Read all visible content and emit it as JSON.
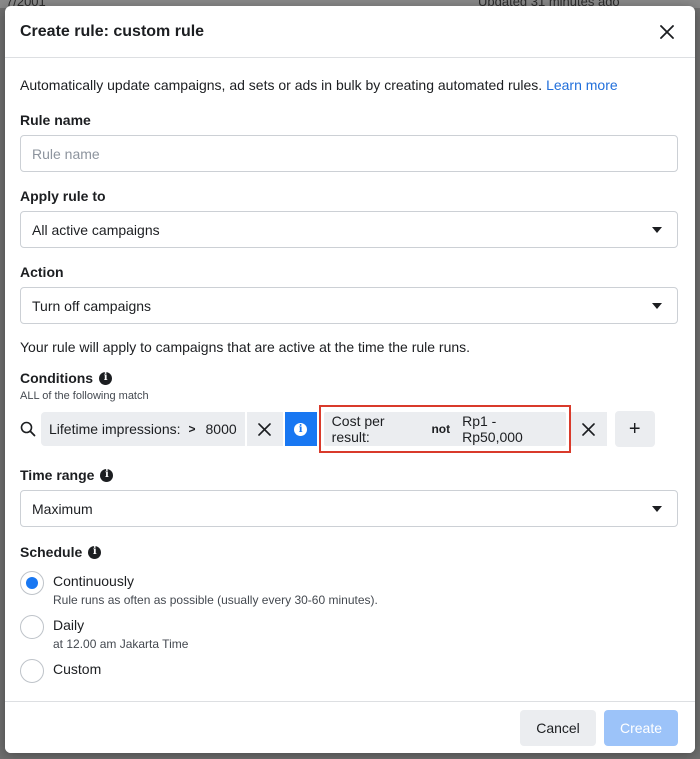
{
  "background": {
    "top_left_text": "7/2001",
    "top_right_text": "Updated 31 minutes ago"
  },
  "modal": {
    "title": "Create rule: custom rule",
    "intro_text": "Automatically update campaigns, ad sets or ads in bulk by creating automated rules.",
    "learn_more": "Learn more",
    "rule_name": {
      "label": "Rule name",
      "placeholder": "Rule name",
      "value": ""
    },
    "apply_rule_to": {
      "label": "Apply rule to",
      "value": "All active campaigns"
    },
    "action": {
      "label": "Action",
      "value": "Turn off campaigns"
    },
    "apply_note": "Your rule will apply to campaigns that are active at the time the rule runs.",
    "conditions": {
      "label": "Conditions",
      "sublabel": "ALL of the following match",
      "items": [
        {
          "metric": "Lifetime impressions:",
          "operator": ">",
          "value": "8000"
        },
        {
          "metric": "Cost per result:",
          "operator": "not",
          "value": "Rp1 - Rp50,000"
        }
      ],
      "add_label": "+"
    },
    "time_range": {
      "label": "Time range",
      "value": "Maximum"
    },
    "schedule": {
      "label": "Schedule",
      "options": [
        {
          "title": "Continuously",
          "desc": "Rule runs as often as possible (usually every 30-60 minutes).",
          "checked": true
        },
        {
          "title": "Daily",
          "desc": "at 12.00 am Jakarta Time",
          "checked": false
        },
        {
          "title": "Custom",
          "desc": "",
          "checked": false
        }
      ]
    },
    "footer": {
      "cancel": "Cancel",
      "create": "Create"
    }
  },
  "colors": {
    "accent": "#1877f2",
    "highlight_border": "#d93a2b",
    "link": "#216fdb",
    "create_disabled": "#9cc3f9"
  }
}
